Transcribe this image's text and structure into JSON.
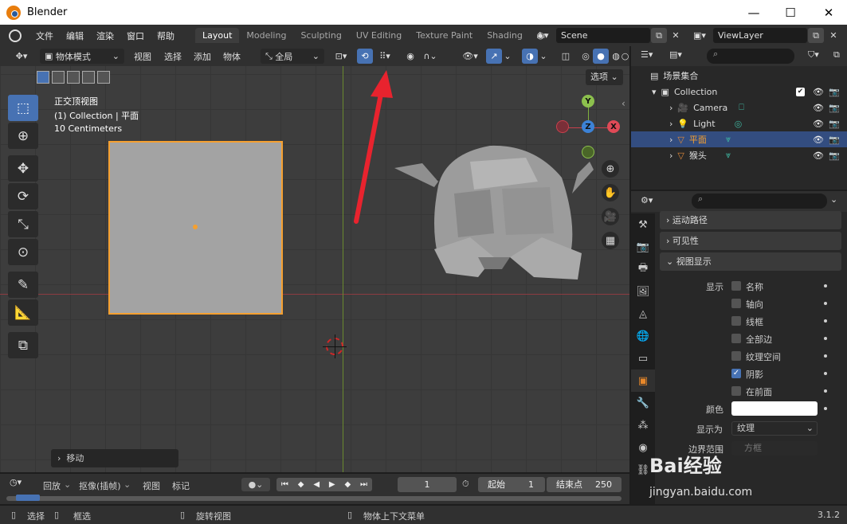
{
  "window": {
    "title": "Blender",
    "minimize": "—",
    "maximize": "☐",
    "close": "✕"
  },
  "menubar": {
    "items": [
      "文件",
      "编辑",
      "渲染",
      "窗口",
      "帮助"
    ],
    "workspaces": [
      "Layout",
      "Modeling",
      "Sculpting",
      "UV Editing",
      "Texture Paint",
      "Shading",
      "Ar"
    ],
    "scene": "Scene",
    "view_layer": "ViewLayer"
  },
  "vp_header": {
    "mode": "物体模式",
    "menus": [
      "视图",
      "选择",
      "添加",
      "物体"
    ],
    "transform_orientation": "全局",
    "options_label": "选项"
  },
  "viewport": {
    "view_name": "正交顶视图",
    "collection_info": "(1) Collection | 平面",
    "scale_info": "10 Centimeters",
    "last_operator": "移动",
    "gizmo": {
      "x": "X",
      "y": "Y",
      "z": "Z"
    }
  },
  "outliner": {
    "root": "场景集合",
    "collection": "Collection",
    "objects": [
      {
        "name": "Camera"
      },
      {
        "name": "Light"
      },
      {
        "name": "平面"
      },
      {
        "name": "猴头"
      }
    ]
  },
  "properties": {
    "panels": [
      "运动路径",
      "可见性",
      "视图显示"
    ],
    "show_label": "显示",
    "checkboxes": [
      {
        "label": "名称",
        "checked": false
      },
      {
        "label": "轴向",
        "checked": false
      },
      {
        "label": "线框",
        "checked": false
      },
      {
        "label": "全部边",
        "checked": false
      },
      {
        "label": "纹理空间",
        "checked": false
      },
      {
        "label": "阴影",
        "checked": true
      },
      {
        "label": "在前面",
        "checked": false
      }
    ],
    "color_label": "颜色",
    "display_as_label": "显示为",
    "display_as_value": "纹理",
    "bounds_label": "边界范围",
    "bounds_value": "方框"
  },
  "timeline": {
    "playback": "回放",
    "keying": "抠像(插帧)",
    "view": "视图",
    "marker": "标记",
    "current_frame": "1",
    "start_label": "起始",
    "start_value": "1",
    "end_label": "结束点",
    "end_value": "250"
  },
  "statusbar": {
    "select": "选择",
    "box_select": "框选",
    "rotate_view": "旋转视图",
    "context_menu": "物体上下文菜单",
    "version": "3.1.2"
  },
  "watermark": {
    "line1": "Bai经验",
    "line2": "jingyan.baidu.com"
  },
  "colors": {
    "accent": "#4772b3",
    "selection": "#f5a030",
    "highlight_row": "#334d80"
  }
}
